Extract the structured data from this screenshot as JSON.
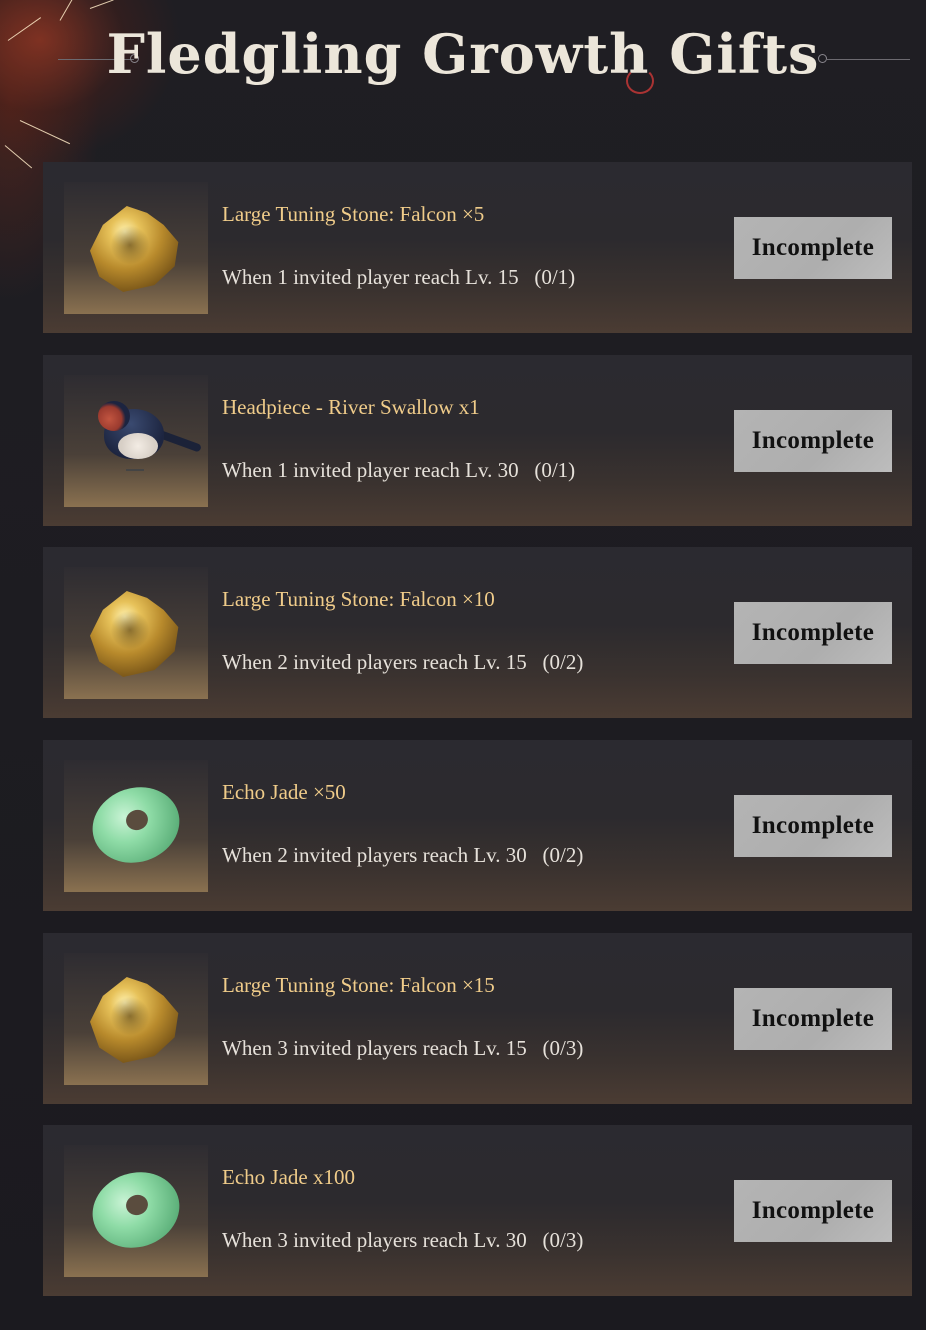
{
  "page": {
    "title": "Fledgling Growth Gifts"
  },
  "rewards": [
    {
      "icon": "tuning-stone",
      "reward": "Large Tuning Stone: Falcon ×5",
      "condition": "When 1 invited player reach Lv. 15",
      "progress": "(0/1)",
      "status": "Incomplete"
    },
    {
      "icon": "swallow-headpiece",
      "reward": "Headpiece - River Swallow x1",
      "condition": "When 1 invited player reach Lv. 30",
      "progress": "(0/1)",
      "status": "Incomplete"
    },
    {
      "icon": "tuning-stone",
      "reward": "Large Tuning Stone: Falcon ×10",
      "condition": "When 2 invited players reach Lv. 15",
      "progress": "(0/2)",
      "status": "Incomplete"
    },
    {
      "icon": "echo-jade",
      "reward": "Echo Jade ×50",
      "condition": "When 2 invited players reach Lv. 30",
      "progress": "(0/2)",
      "status": "Incomplete"
    },
    {
      "icon": "tuning-stone",
      "reward": "Large Tuning Stone: Falcon ×15",
      "condition": "When 3 invited players reach Lv. 15",
      "progress": "(0/3)",
      "status": "Incomplete"
    },
    {
      "icon": "echo-jade",
      "reward": "Echo Jade x100",
      "condition": "When 3 invited players reach Lv. 30",
      "progress": "(0/3)",
      "status": "Incomplete"
    }
  ],
  "colors": {
    "reward_text": "#f0cc8a",
    "condition_text": "#e6e1da",
    "button_bg": "#b4b4b4"
  }
}
